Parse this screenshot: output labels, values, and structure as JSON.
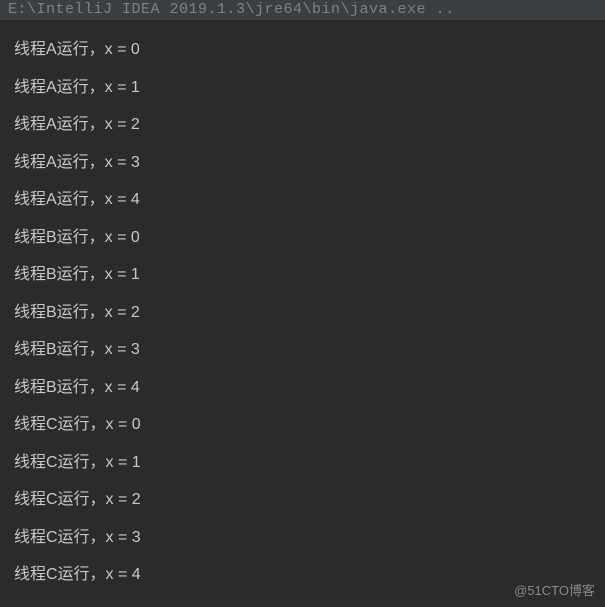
{
  "header": {
    "path": "E:\\IntelliJ IDEA 2019.1.3\\jre64\\bin\\java.exe  .."
  },
  "console": {
    "lines": [
      "线程A运行，x = 0",
      "线程A运行，x = 1",
      "线程A运行，x = 2",
      "线程A运行，x = 3",
      "线程A运行，x = 4",
      "线程B运行，x = 0",
      "线程B运行，x = 1",
      "线程B运行，x = 2",
      "线程B运行，x = 3",
      "线程B运行，x = 4",
      "线程C运行，x = 0",
      "线程C运行，x = 1",
      "线程C运行，x = 2",
      "线程C运行，x = 3",
      "线程C运行，x = 4"
    ]
  },
  "watermark": {
    "text": "@51CTO博客"
  }
}
